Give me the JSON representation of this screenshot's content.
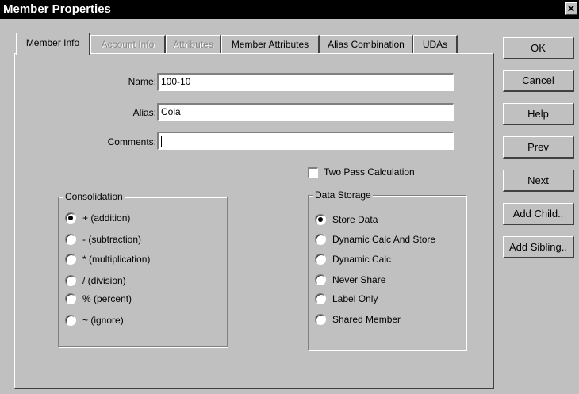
{
  "window": {
    "title": "Member Properties",
    "close_glyph": "✕"
  },
  "tabs": [
    {
      "label": "Member Info",
      "state": "active"
    },
    {
      "label": "Account Info",
      "state": "disabled"
    },
    {
      "label": "Attributes",
      "state": "disabled"
    },
    {
      "label": "Member Attributes",
      "state": "enabled"
    },
    {
      "label": "Alias Combination",
      "state": "enabled"
    },
    {
      "label": "UDAs",
      "state": "enabled"
    }
  ],
  "form": {
    "name_label": "Name:",
    "name_value": "100-10",
    "alias_label": "Alias:",
    "alias_value": "Cola",
    "comments_label": "Comments:",
    "comments_value": "",
    "two_pass_label": "Two Pass Calculation",
    "two_pass_checked": false
  },
  "consolidation": {
    "legend": "Consolidation",
    "options": [
      {
        "label": "+ (addition)",
        "checked": true
      },
      {
        "label": "- (subtraction)",
        "checked": false
      },
      {
        "label": "* (multiplication)",
        "checked": false
      },
      {
        "label": "/ (division)",
        "checked": false
      },
      {
        "label": "% (percent)",
        "checked": false
      },
      {
        "label": "~ (ignore)",
        "checked": false
      }
    ]
  },
  "data_storage": {
    "legend": "Data Storage",
    "options": [
      {
        "label": "Store Data",
        "checked": true
      },
      {
        "label": "Dynamic Calc And Store",
        "checked": false
      },
      {
        "label": "Dynamic Calc",
        "checked": false
      },
      {
        "label": "Never Share",
        "checked": false
      },
      {
        "label": "Label Only",
        "checked": false
      },
      {
        "label": "Shared Member",
        "checked": false
      }
    ]
  },
  "buttons": {
    "ok": "OK",
    "cancel": "Cancel",
    "help": "Help",
    "prev": "Prev",
    "next": "Next",
    "add_child": "Add Child..",
    "add_sibling": "Add Sibling.."
  }
}
